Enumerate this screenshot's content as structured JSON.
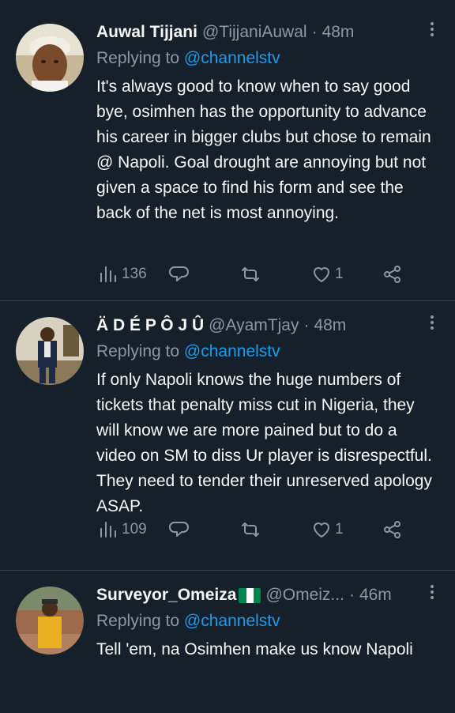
{
  "tweets": [
    {
      "name": "Auwal Tijjani",
      "handle": "@TijjaniAuwal",
      "dot": "·",
      "time": "48m",
      "reply_prefix": "Replying to",
      "reply_to": "@channelstv",
      "text": "It's always good to know when to say good bye, osimhen has the opportunity to advance his career in bigger clubs but chose to remain @ Napoli. Goal drought are annoying but not given a space to find his form and see the back of the net is most annoying.",
      "views": "136",
      "likes": "1"
    },
    {
      "name": "Ä D É P Ô J Û",
      "handle": "@AyamTjay",
      "dot": "·",
      "time": "48m",
      "reply_prefix": "Replying to",
      "reply_to": "@channelstv",
      "text": "If only Napoli knows the huge numbers of tickets that penalty miss cut in Nigeria, they will know we are more pained but to do a video on SM to diss Ur player is disrespectful. They need to tender their unreserved apology ASAP.",
      "views": "109",
      "likes": "1"
    },
    {
      "name": "Surveyor_Omeiza",
      "handle": "@Omeiz...",
      "dot": "·",
      "time": "46m",
      "reply_prefix": "Replying to",
      "reply_to": "@channelstv",
      "text": "Tell 'em, na Osimhen make us know Napoli",
      "flag_colors": [
        "#008751",
        "#ffffff",
        "#008751"
      ]
    }
  ],
  "icons": {
    "views": "bar-chart-icon",
    "reply": "speech-bubble-icon",
    "retweet": "retweet-icon",
    "like": "heart-icon",
    "share": "share-icon",
    "more": "more-vertical-icon"
  },
  "colors": {
    "background": "#15202b",
    "text": "#f7f9f9",
    "muted": "#8b98a5",
    "accent": "#1d9bf0",
    "divider": "#38444d"
  }
}
